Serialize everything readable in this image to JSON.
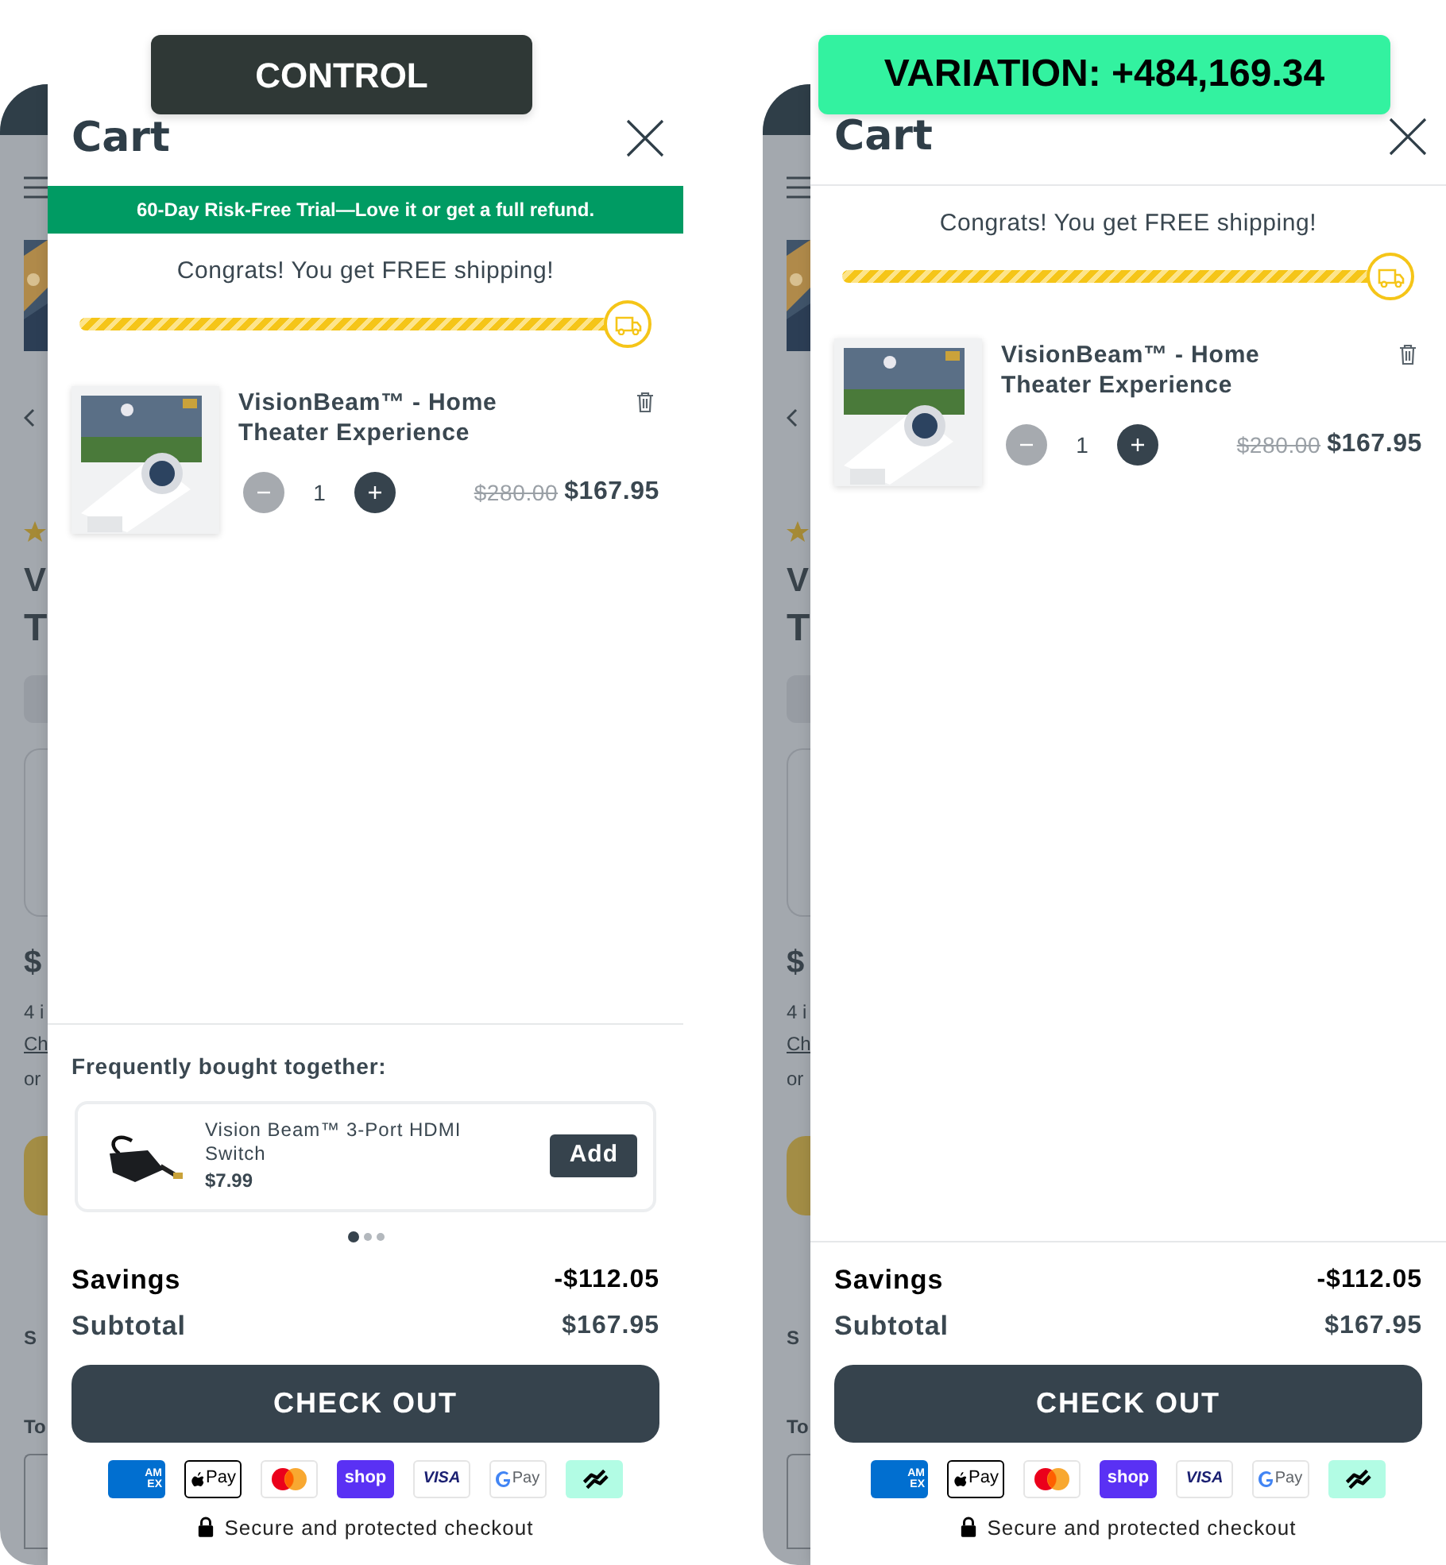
{
  "variants": [
    {
      "badge": {
        "text": "CONTROL",
        "kind": "control"
      },
      "background_page": {
        "fragments": [
          "V",
          "T",
          "$",
          "4 i",
          "Ch",
          "or",
          "S",
          "To"
        ]
      },
      "cart": {
        "title": "Cart",
        "trial_banner": "60-Day Risk-Free Trial—Love it or get a full refund.",
        "shipping": {
          "message": "Congrats! You get FREE shipping!",
          "level": 1
        },
        "items": [
          {
            "name": "VisionBeam™ - Home Theater Experience",
            "quantity": "1",
            "minus_disabled": true,
            "compare_price": "$280.00",
            "price": "$167.95"
          }
        ],
        "upsell": {
          "title": "Frequently bought together:",
          "products": [
            {
              "name": "Vision Beam™ 3-Port HDMI Switch",
              "price": "$7.99",
              "button": "Add"
            }
          ],
          "dots": [
            {
              "selected": true
            },
            {
              "selected": false
            },
            {
              "selected": false
            }
          ]
        },
        "summary": [
          {
            "label": "Savings",
            "value": "-$112.05",
            "kind": "savings"
          },
          {
            "label": "Subtotal",
            "value": "$167.95",
            "kind": "subtotal"
          }
        ],
        "checkout_button": "CHECK OUT",
        "payment_methods": [
          {
            "kind": "amex",
            "label": "AM EX"
          },
          {
            "kind": "applepay",
            "label": "Pay"
          },
          {
            "kind": "mastercard"
          },
          {
            "kind": "shop",
            "label": "shop"
          },
          {
            "kind": "visa",
            "label": "VISA"
          },
          {
            "kind": "gpay",
            "label": "Pay"
          },
          {
            "kind": "afterpay"
          }
        ],
        "secure_note": "Secure and protected checkout"
      }
    },
    {
      "badge": {
        "text": "VARIATION: +484,169.34",
        "kind": "variation"
      },
      "background_page": {
        "fragments": [
          "V",
          "T",
          "$",
          "4 i",
          "Ch",
          "or",
          "S",
          "To"
        ]
      },
      "cart": {
        "title": "Cart",
        "shipping": {
          "message": "Congrats! You get FREE shipping!",
          "level": 1
        },
        "items": [
          {
            "name": "VisionBeam™ - Home Theater Experience",
            "quantity": "1",
            "minus_disabled": true,
            "compare_price": "$280.00",
            "price": "$167.95"
          }
        ],
        "summary": [
          {
            "label": "Savings",
            "value": "-$112.05",
            "kind": "savings"
          },
          {
            "label": "Subtotal",
            "value": "$167.95",
            "kind": "subtotal"
          }
        ],
        "checkout_button": "CHECK OUT",
        "payment_methods": [
          {
            "kind": "amex",
            "label": "AM EX"
          },
          {
            "kind": "applepay",
            "label": "Pay"
          },
          {
            "kind": "mastercard"
          },
          {
            "kind": "shop",
            "label": "shop"
          },
          {
            "kind": "visa",
            "label": "VISA"
          },
          {
            "kind": "gpay",
            "label": "Pay"
          },
          {
            "kind": "afterpay"
          }
        ],
        "secure_note": "Secure and protected checkout"
      }
    }
  ]
}
